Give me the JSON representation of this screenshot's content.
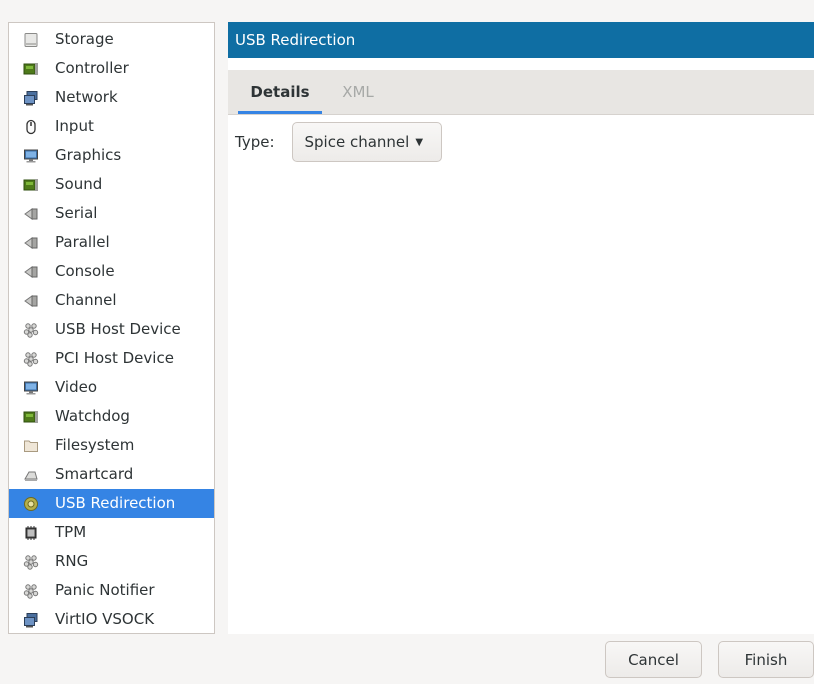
{
  "sidebar": {
    "items": [
      {
        "label": "Storage",
        "icon": "storage-icon"
      },
      {
        "label": "Controller",
        "icon": "controller-icon"
      },
      {
        "label": "Network",
        "icon": "network-icon"
      },
      {
        "label": "Input",
        "icon": "mouse-icon"
      },
      {
        "label": "Graphics",
        "icon": "monitor-icon"
      },
      {
        "label": "Sound",
        "icon": "sound-card-icon"
      },
      {
        "label": "Serial",
        "icon": "serial-port-icon"
      },
      {
        "label": "Parallel",
        "icon": "parallel-port-icon"
      },
      {
        "label": "Console",
        "icon": "console-port-icon"
      },
      {
        "label": "Channel",
        "icon": "channel-port-icon"
      },
      {
        "label": "USB Host Device",
        "icon": "usb-host-device-icon"
      },
      {
        "label": "PCI Host Device",
        "icon": "pci-host-device-icon"
      },
      {
        "label": "Video",
        "icon": "video-monitor-icon"
      },
      {
        "label": "Watchdog",
        "icon": "watchdog-card-icon"
      },
      {
        "label": "Filesystem",
        "icon": "folder-icon"
      },
      {
        "label": "Smartcard",
        "icon": "smartcard-icon"
      },
      {
        "label": "USB Redirection",
        "icon": "usb-redirection-icon",
        "selected": true
      },
      {
        "label": "TPM",
        "icon": "chip-icon"
      },
      {
        "label": "RNG",
        "icon": "rng-device-icon"
      },
      {
        "label": "Panic Notifier",
        "icon": "panic-notifier-icon"
      },
      {
        "label": "VirtIO VSOCK",
        "icon": "vsock-network-icon"
      }
    ]
  },
  "main": {
    "title": "USB Redirection",
    "tabs": [
      {
        "label": "Details",
        "active": true
      },
      {
        "label": "XML",
        "active": false
      }
    ],
    "type_label": "Type:",
    "type_value": "Spice channel"
  },
  "footer": {
    "cancel_label": "Cancel",
    "finish_label": "Finish"
  },
  "colors": {
    "accent": "#3584e4",
    "title_bar": "#0f6ea3"
  }
}
